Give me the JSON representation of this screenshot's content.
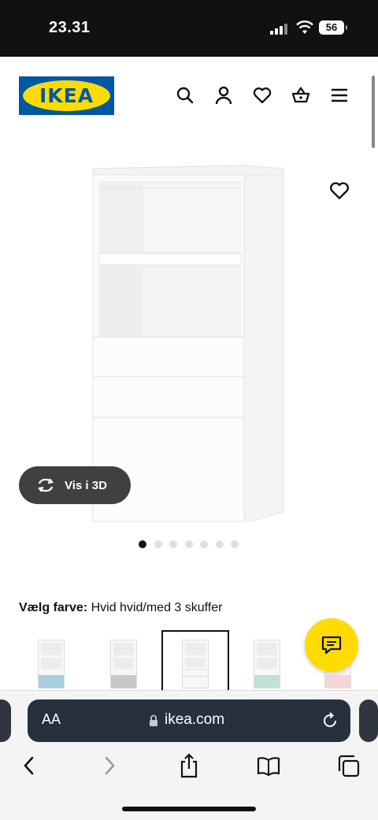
{
  "status": {
    "time": "23.31",
    "battery": "56"
  },
  "header": {
    "logo_text": "IKEA",
    "brand_blue": "#0058a3",
    "brand_yellow": "#ffdb00",
    "icons": [
      "search-icon",
      "account-icon",
      "heart-icon",
      "basket-icon",
      "menu-icon"
    ]
  },
  "product": {
    "view3d_label": "Vis i 3D",
    "image_count": 7,
    "active_image": 1,
    "color_prompt": "Vælg farve:",
    "color_value": "Hvid hvid/med 3 skuffer",
    "swatches": [
      {
        "name": "white-light-blue",
        "accent": "#a9cfdc"
      },
      {
        "name": "white-grey",
        "accent": "#c8c8c8"
      },
      {
        "name": "white-white",
        "accent": "#ffffff",
        "selected": true
      },
      {
        "name": "white-mint",
        "accent": "#bfe3d3"
      },
      {
        "name": "white-pink",
        "accent": "#f6d6d8"
      }
    ]
  },
  "browser": {
    "aa_label": "AA",
    "url": "ikea.com"
  }
}
